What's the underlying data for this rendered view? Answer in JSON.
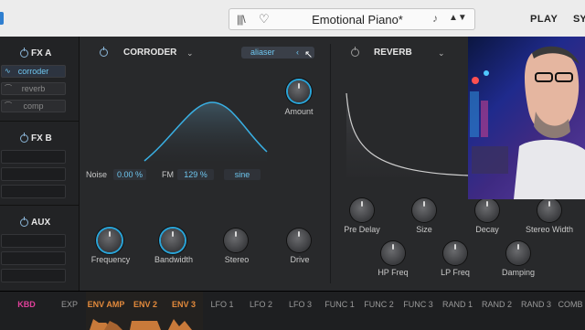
{
  "topbar": {
    "preset_name": "Emotional Piano*",
    "play_label": "PLAY",
    "synth_label": "SY"
  },
  "fx_a": {
    "title": "FX A",
    "slots": [
      "corroder",
      "reverb",
      "comp"
    ],
    "active_slot": "corroder"
  },
  "fx_b": {
    "title": "FX B"
  },
  "aux": {
    "title": "AUX"
  },
  "corroder": {
    "title": "CORRODER",
    "mode": "aliaser",
    "amount_label": "Amount",
    "noise_label": "Noise",
    "noise_value": "0.00 %",
    "fm_label": "FM",
    "fm_value": "129 %",
    "wave_value": "sine",
    "knobs": [
      "Frequency",
      "Bandwidth",
      "Stereo",
      "Drive"
    ]
  },
  "reverb": {
    "title": "REVERB",
    "knobs_row1": [
      "Pre Delay",
      "Size",
      "Decay",
      "Stereo Width"
    ],
    "knobs_row2": [
      "HP Freq",
      "LP Freq",
      "Damping"
    ]
  },
  "bottom_tabs": [
    "KBD",
    "EXP",
    "ENV AMP",
    "ENV 2",
    "ENV 3",
    "LFO 1",
    "LFO 2",
    "LFO 3",
    "FUNC 1",
    "FUNC 2",
    "FUNC 3",
    "RAND 1",
    "RAND 2",
    "RAND 3",
    "COMB"
  ],
  "colors": {
    "accent": "#2aa4d8",
    "kbd": "#e0409a",
    "env": "#e38a3c",
    "panel": "#28292b"
  }
}
